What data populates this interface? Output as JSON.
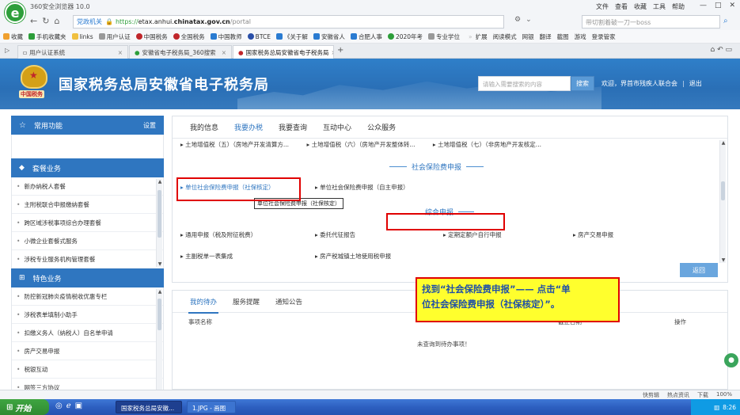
{
  "browser": {
    "title": "360安全浏览器 10.0",
    "menus": [
      "文件",
      "查看",
      "收藏",
      "工具",
      "帮助"
    ],
    "address": {
      "security_label": "党政机关",
      "protocol": "https://",
      "host_prefix": "etax.",
      "host_mid": "anhui.",
      "host_main": "chinatax.gov.cn",
      "path": "/portal"
    },
    "search_placeholder": "带切割着破一刀一boss",
    "favorites": [
      {
        "label": "收藏",
        "color": "#f0a030"
      },
      {
        "label": "手机收藏夹",
        "color": "#2d9e3a"
      },
      {
        "label": "links",
        "color": "#f0c040"
      },
      {
        "label": "用户认证",
        "color": "#999999"
      },
      {
        "label": "中国税务",
        "color": "#c0262b"
      },
      {
        "label": "全国税务",
        "color": "#c0262b"
      },
      {
        "label": "中国教师",
        "color": "#2a7bd1"
      },
      {
        "label": "BTCE",
        "color": "#2a4fa8"
      },
      {
        "label": "《关于解",
        "color": "#2a7bd1"
      },
      {
        "label": "安徽省人",
        "color": "#2a7bd1"
      },
      {
        "label": "合肥人事",
        "color": "#2a7bd1"
      },
      {
        "label": "2020年考",
        "color": "#2d9e3a"
      },
      {
        "label": "专业学位",
        "color": "#999999"
      }
    ],
    "fav_right": [
      "扩展",
      "阅读模式",
      "网银",
      "翻译",
      "截图",
      "游戏",
      "登录管家"
    ],
    "tabs": [
      {
        "label": "用户认证系统",
        "active": false
      },
      {
        "label": "安徽省电子税务局_360搜索",
        "active": false
      },
      {
        "label": "国家税务总局安徽省电子税务局",
        "active": true
      }
    ]
  },
  "site": {
    "title": "国家税务总局安徽省电子税务局",
    "emblem_seal": "中国税务",
    "search_placeholder": "请输入需要搜索的内容",
    "search_button": "搜索",
    "welcome": "欢迎，界首市残疾人联合会",
    "logout": "退出"
  },
  "sidebar": {
    "common_title": "常用功能",
    "common_settings": "设置",
    "package_title": "套餐业务",
    "package_items": [
      "新办纳税人套餐",
      "主附税联合申报缴纳套餐",
      "跨区域涉税事项综合办理套餐",
      "小微企业套餐式服务",
      "涉税专业服务机构管理套餐"
    ],
    "special_title": "特色业务",
    "special_items": [
      "防控新冠肺炎疫情税收优惠专栏",
      "涉税表单填制小助手",
      "扣缴义务人（纳税人）自名单申请",
      "房产交易申报",
      "税银互动",
      "网签三方协议"
    ]
  },
  "main": {
    "tabs": [
      "我的信息",
      "我要办税",
      "我要查询",
      "互动中心",
      "公众服务"
    ],
    "active_tab": "我要办税",
    "top_row": [
      "土地增值税（五）（房地产开发清算方...",
      "土地增值税（六）（房地产开发整体转...",
      "土地增值税（七）（非房地产开发核定..."
    ],
    "section_social": "社会保险费申报",
    "social_links": [
      "单位社会保险费申报（社保核定）",
      "单位社会保险费申报（自主申报）"
    ],
    "tooltip": "单位社会保险费申报（社保核定）",
    "section_general": "综合申报",
    "general_links": [
      "通用申报（税及附征税费）",
      "委托代征报告",
      "定期定额户自行申报",
      "房产交易申报"
    ],
    "bottom_links": [
      "主副税单一表集成",
      "房产税城镇土地使用税申报"
    ],
    "back_button": "返回"
  },
  "todo": {
    "tabs": [
      "我的待办",
      "服务提醒",
      "通知公告"
    ],
    "active_tab": "我的待办",
    "headers": [
      "事项名称",
      "截止日期",
      "操作"
    ],
    "empty_text": "未查询到待办事项！"
  },
  "callout": {
    "line1": "找到“社会保险费申报”—— 点击“单",
    "line2": "位社会保险费申报（社保核定）”。"
  },
  "statusbar": {
    "items": [
      "快剪辑",
      "热点资讯",
      "下载",
      "100%"
    ]
  },
  "taskbar": {
    "start_label": "开始",
    "tasks": [
      {
        "label": "国家税务总局安徽...",
        "active": true
      },
      {
        "label": "1.JPG - 画图",
        "active": false
      }
    ],
    "time": "8:26"
  }
}
